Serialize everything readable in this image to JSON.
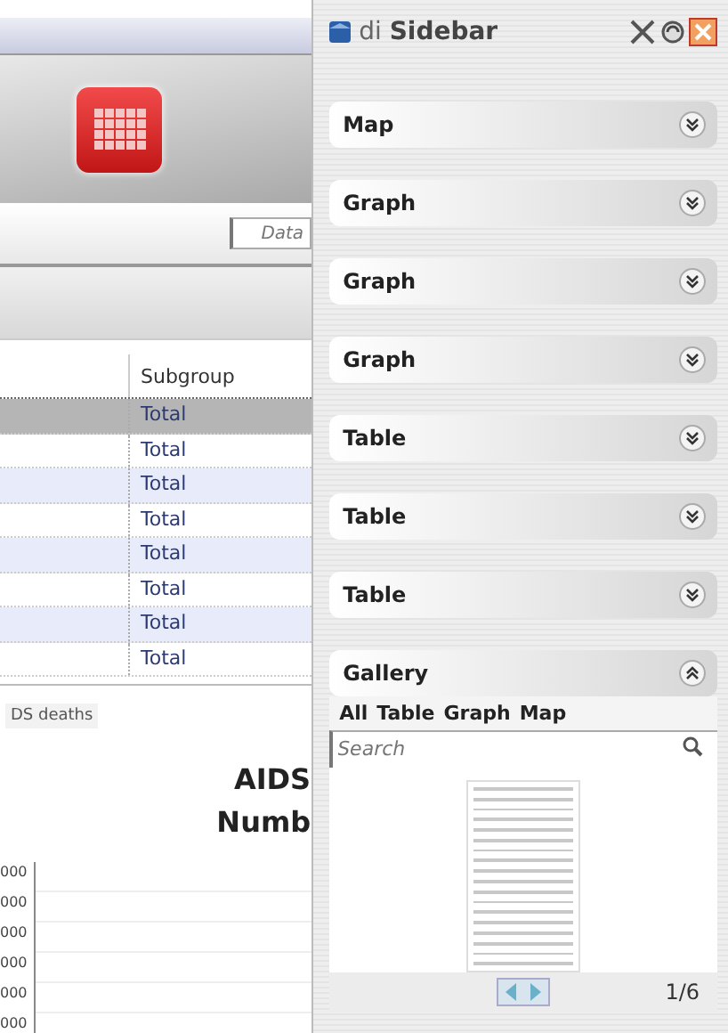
{
  "main": {
    "search_field": {
      "placeholder": "Data"
    },
    "table": {
      "columns": [
        "Subgroup"
      ],
      "rows": [
        {
          "cells": [
            "Total"
          ],
          "selected": true
        },
        {
          "cells": [
            "Total"
          ],
          "selected": false
        },
        {
          "cells": [
            "Total"
          ],
          "selected": false
        },
        {
          "cells": [
            "Total"
          ],
          "selected": false
        },
        {
          "cells": [
            "Total"
          ],
          "selected": false
        },
        {
          "cells": [
            "Total"
          ],
          "selected": false
        },
        {
          "cells": [
            "Total"
          ],
          "selected": false
        },
        {
          "cells": [
            "Total"
          ],
          "selected": false
        }
      ]
    },
    "chart_tab": "DS deaths",
    "chart_title": [
      "AIDS",
      "Numb"
    ],
    "chart_axis_labels": [
      "000",
      "000",
      "000",
      "000",
      "000",
      "000"
    ]
  },
  "sidebar": {
    "title_prefix": "di",
    "title": "Sidebar",
    "panels": [
      {
        "label": "Map",
        "expanded": false
      },
      {
        "label": "Graph",
        "expanded": false
      },
      {
        "label": "Graph",
        "expanded": false
      },
      {
        "label": "Graph",
        "expanded": false
      },
      {
        "label": "Table",
        "expanded": false
      },
      {
        "label": "Table",
        "expanded": false
      },
      {
        "label": "Table",
        "expanded": false
      },
      {
        "label": "Gallery",
        "expanded": true
      }
    ],
    "gallery": {
      "filters": [
        "All",
        "Table",
        "Graph",
        "Map"
      ],
      "search": {
        "placeholder": "Search"
      },
      "pager": "1/6"
    }
  }
}
